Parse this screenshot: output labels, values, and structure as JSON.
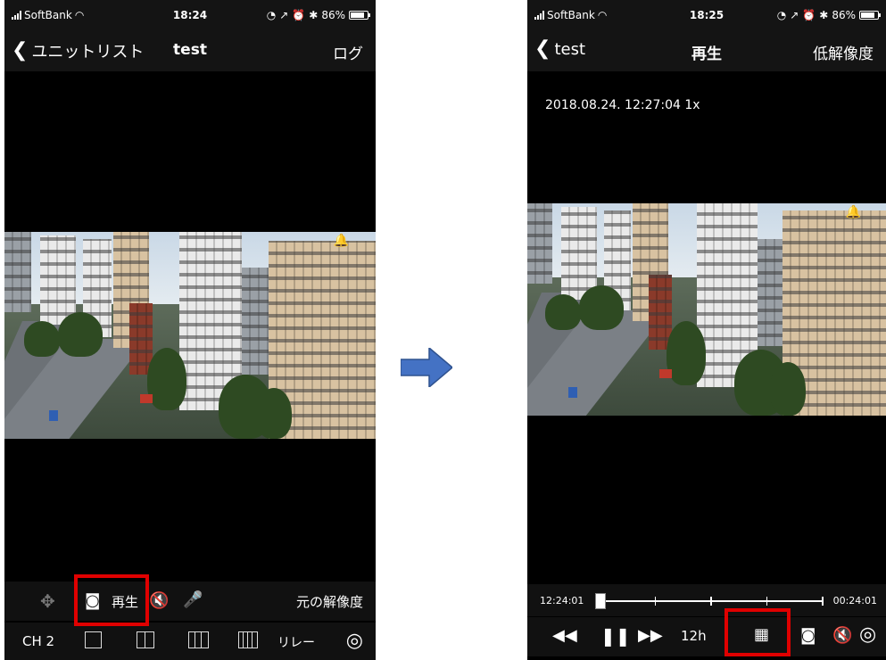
{
  "left": {
    "status": {
      "carrier": "SoftBank",
      "time": "18:24",
      "battery": "86%"
    },
    "nav": {
      "back_label": "ユニットリスト",
      "title": "test",
      "right_label": "ログ"
    },
    "controls_row1": {
      "play_label": "再生",
      "resolution_label": "元の解像度"
    },
    "controls_row2": {
      "channel_label": "CH 2",
      "relay_label": "リレー"
    }
  },
  "right": {
    "status": {
      "carrier": "SoftBank",
      "time": "18:25",
      "battery": "86%"
    },
    "nav": {
      "back_label": "test",
      "title": "再生",
      "right_label": "低解像度"
    },
    "timestamp": "2018.08.24. 12:27:04 1x",
    "timeline": {
      "start": "12:24:01",
      "end": "00:24:01"
    },
    "playback": {
      "speed_label": "12h"
    }
  },
  "icons": {
    "signal": "signal-bars",
    "wifi": "wifi-icon",
    "camera": "camera-icon",
    "mute": "speaker-mute-icon",
    "mic": "mic-mute-icon",
    "calendar": "calendar-icon",
    "rotate": "rotate-icon",
    "rewind": "rewind-icon",
    "pause": "pause-icon",
    "forward": "fast-forward-icon",
    "ptz": "ptz-icon"
  },
  "colors": {
    "highlight": "#e00000",
    "arrow": "#4472c4",
    "accent_text": "#ffffff"
  }
}
